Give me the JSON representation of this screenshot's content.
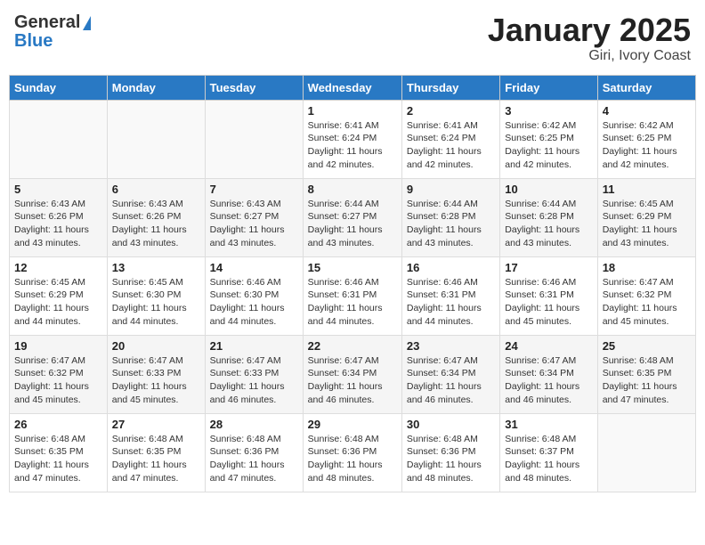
{
  "header": {
    "logo_general": "General",
    "logo_blue": "Blue",
    "title": "January 2025",
    "location": "Giri, Ivory Coast"
  },
  "columns": [
    "Sunday",
    "Monday",
    "Tuesday",
    "Wednesday",
    "Thursday",
    "Friday",
    "Saturday"
  ],
  "weeks": [
    [
      {
        "date": "",
        "sunrise": "",
        "sunset": "",
        "daylight": ""
      },
      {
        "date": "",
        "sunrise": "",
        "sunset": "",
        "daylight": ""
      },
      {
        "date": "",
        "sunrise": "",
        "sunset": "",
        "daylight": ""
      },
      {
        "date": "1",
        "sunrise": "Sunrise: 6:41 AM",
        "sunset": "Sunset: 6:24 PM",
        "daylight": "Daylight: 11 hours and 42 minutes."
      },
      {
        "date": "2",
        "sunrise": "Sunrise: 6:41 AM",
        "sunset": "Sunset: 6:24 PM",
        "daylight": "Daylight: 11 hours and 42 minutes."
      },
      {
        "date": "3",
        "sunrise": "Sunrise: 6:42 AM",
        "sunset": "Sunset: 6:25 PM",
        "daylight": "Daylight: 11 hours and 42 minutes."
      },
      {
        "date": "4",
        "sunrise": "Sunrise: 6:42 AM",
        "sunset": "Sunset: 6:25 PM",
        "daylight": "Daylight: 11 hours and 42 minutes."
      }
    ],
    [
      {
        "date": "5",
        "sunrise": "Sunrise: 6:43 AM",
        "sunset": "Sunset: 6:26 PM",
        "daylight": "Daylight: 11 hours and 43 minutes."
      },
      {
        "date": "6",
        "sunrise": "Sunrise: 6:43 AM",
        "sunset": "Sunset: 6:26 PM",
        "daylight": "Daylight: 11 hours and 43 minutes."
      },
      {
        "date": "7",
        "sunrise": "Sunrise: 6:43 AM",
        "sunset": "Sunset: 6:27 PM",
        "daylight": "Daylight: 11 hours and 43 minutes."
      },
      {
        "date": "8",
        "sunrise": "Sunrise: 6:44 AM",
        "sunset": "Sunset: 6:27 PM",
        "daylight": "Daylight: 11 hours and 43 minutes."
      },
      {
        "date": "9",
        "sunrise": "Sunrise: 6:44 AM",
        "sunset": "Sunset: 6:28 PM",
        "daylight": "Daylight: 11 hours and 43 minutes."
      },
      {
        "date": "10",
        "sunrise": "Sunrise: 6:44 AM",
        "sunset": "Sunset: 6:28 PM",
        "daylight": "Daylight: 11 hours and 43 minutes."
      },
      {
        "date": "11",
        "sunrise": "Sunrise: 6:45 AM",
        "sunset": "Sunset: 6:29 PM",
        "daylight": "Daylight: 11 hours and 43 minutes."
      }
    ],
    [
      {
        "date": "12",
        "sunrise": "Sunrise: 6:45 AM",
        "sunset": "Sunset: 6:29 PM",
        "daylight": "Daylight: 11 hours and 44 minutes."
      },
      {
        "date": "13",
        "sunrise": "Sunrise: 6:45 AM",
        "sunset": "Sunset: 6:30 PM",
        "daylight": "Daylight: 11 hours and 44 minutes."
      },
      {
        "date": "14",
        "sunrise": "Sunrise: 6:46 AM",
        "sunset": "Sunset: 6:30 PM",
        "daylight": "Daylight: 11 hours and 44 minutes."
      },
      {
        "date": "15",
        "sunrise": "Sunrise: 6:46 AM",
        "sunset": "Sunset: 6:31 PM",
        "daylight": "Daylight: 11 hours and 44 minutes."
      },
      {
        "date": "16",
        "sunrise": "Sunrise: 6:46 AM",
        "sunset": "Sunset: 6:31 PM",
        "daylight": "Daylight: 11 hours and 44 minutes."
      },
      {
        "date": "17",
        "sunrise": "Sunrise: 6:46 AM",
        "sunset": "Sunset: 6:31 PM",
        "daylight": "Daylight: 11 hours and 45 minutes."
      },
      {
        "date": "18",
        "sunrise": "Sunrise: 6:47 AM",
        "sunset": "Sunset: 6:32 PM",
        "daylight": "Daylight: 11 hours and 45 minutes."
      }
    ],
    [
      {
        "date": "19",
        "sunrise": "Sunrise: 6:47 AM",
        "sunset": "Sunset: 6:32 PM",
        "daylight": "Daylight: 11 hours and 45 minutes."
      },
      {
        "date": "20",
        "sunrise": "Sunrise: 6:47 AM",
        "sunset": "Sunset: 6:33 PM",
        "daylight": "Daylight: 11 hours and 45 minutes."
      },
      {
        "date": "21",
        "sunrise": "Sunrise: 6:47 AM",
        "sunset": "Sunset: 6:33 PM",
        "daylight": "Daylight: 11 hours and 46 minutes."
      },
      {
        "date": "22",
        "sunrise": "Sunrise: 6:47 AM",
        "sunset": "Sunset: 6:34 PM",
        "daylight": "Daylight: 11 hours and 46 minutes."
      },
      {
        "date": "23",
        "sunrise": "Sunrise: 6:47 AM",
        "sunset": "Sunset: 6:34 PM",
        "daylight": "Daylight: 11 hours and 46 minutes."
      },
      {
        "date": "24",
        "sunrise": "Sunrise: 6:47 AM",
        "sunset": "Sunset: 6:34 PM",
        "daylight": "Daylight: 11 hours and 46 minutes."
      },
      {
        "date": "25",
        "sunrise": "Sunrise: 6:48 AM",
        "sunset": "Sunset: 6:35 PM",
        "daylight": "Daylight: 11 hours and 47 minutes."
      }
    ],
    [
      {
        "date": "26",
        "sunrise": "Sunrise: 6:48 AM",
        "sunset": "Sunset: 6:35 PM",
        "daylight": "Daylight: 11 hours and 47 minutes."
      },
      {
        "date": "27",
        "sunrise": "Sunrise: 6:48 AM",
        "sunset": "Sunset: 6:35 PM",
        "daylight": "Daylight: 11 hours and 47 minutes."
      },
      {
        "date": "28",
        "sunrise": "Sunrise: 6:48 AM",
        "sunset": "Sunset: 6:36 PM",
        "daylight": "Daylight: 11 hours and 47 minutes."
      },
      {
        "date": "29",
        "sunrise": "Sunrise: 6:48 AM",
        "sunset": "Sunset: 6:36 PM",
        "daylight": "Daylight: 11 hours and 48 minutes."
      },
      {
        "date": "30",
        "sunrise": "Sunrise: 6:48 AM",
        "sunset": "Sunset: 6:36 PM",
        "daylight": "Daylight: 11 hours and 48 minutes."
      },
      {
        "date": "31",
        "sunrise": "Sunrise: 6:48 AM",
        "sunset": "Sunset: 6:37 PM",
        "daylight": "Daylight: 11 hours and 48 minutes."
      },
      {
        "date": "",
        "sunrise": "",
        "sunset": "",
        "daylight": ""
      }
    ]
  ]
}
